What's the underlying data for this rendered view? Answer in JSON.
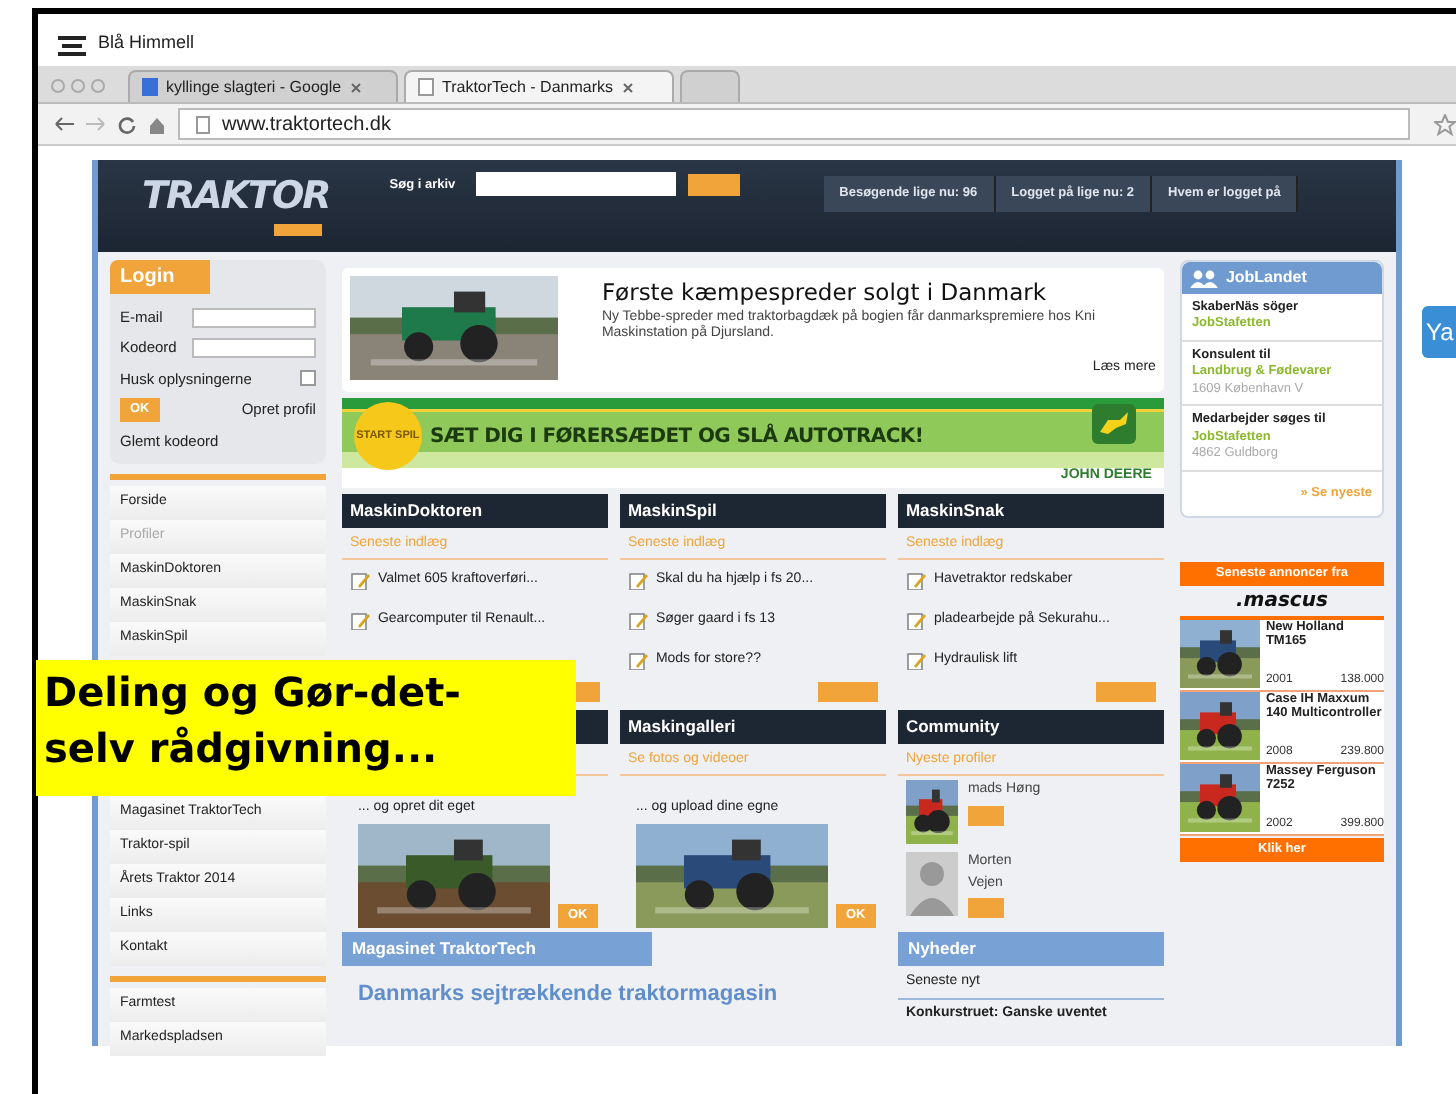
{
  "slide": {
    "caption": "Deling og Gør-det-selv rådgivning..."
  },
  "browser": {
    "app_title": "Blå Himmell",
    "tabs": [
      {
        "label": "kyllinge slagteri - Google",
        "selected": false
      },
      {
        "label": "TraktorTech - Danmarks",
        "selected": true
      }
    ],
    "address": "www.traktortech.dk"
  },
  "header": {
    "logo": "TRAKTOR",
    "search_label": "Søg i arkiv",
    "stats": [
      "Besøgende lige nu: 96",
      "Logget på lige nu: 2",
      "Hvem er logget på"
    ]
  },
  "login": {
    "title": "Login",
    "email_label": "E-mail",
    "password_label": "Kodeord",
    "remember_label": "Husk oplysningerne",
    "remember_checked": false,
    "ok": "OK",
    "create": "Opret profil",
    "forgot": "Glemt kodeord"
  },
  "nav_groups": [
    {
      "divider_before": true,
      "items": [
        {
          "label": "Forside",
          "disabled": false
        },
        {
          "label": "Profiler",
          "disabled": true
        },
        {
          "label": "MaskinDoktoren",
          "disabled": false
        },
        {
          "label": "MaskinSnak",
          "disabled": false
        },
        {
          "label": "MaskinSpil",
          "disabled": false
        }
      ]
    },
    {
      "divider_before": false,
      "items": [
        {
          "label": "Magasinet TraktorTech",
          "disabled": false
        },
        {
          "label": "Traktor-spil",
          "disabled": false
        },
        {
          "label": "Årets Traktor 2014",
          "disabled": false
        },
        {
          "label": "Links",
          "disabled": false
        },
        {
          "label": "Kontakt",
          "disabled": false
        }
      ]
    },
    {
      "divider_before": true,
      "items": [
        {
          "label": "Farmtest",
          "disabled": false
        },
        {
          "label": "Markedspladsen",
          "disabled": false
        }
      ]
    }
  ],
  "feature": {
    "title": "Første kæmpespreder solgt i Danmark",
    "text": "Ny Tebbe-spreder med traktorbagdæk på bogien får danmarkspremiere hos Kni Maskinstation på Djursland.",
    "more": "Læs mere"
  },
  "banner": {
    "badge": "START SPIL",
    "text": "SÆT DIG I FØRERSÆDET OG SLÅ AUTOTRACK!",
    "brand": "JOHN DEERE"
  },
  "forums": [
    {
      "title": "MaskinDoktoren",
      "subtitle": "Seneste indlæg",
      "posts": [
        "Valmet 605 kraftoverføri...",
        "Gearcomputer til Renault..."
      ]
    },
    {
      "title": "MaskinSpil",
      "subtitle": "Seneste indlæg",
      "posts": [
        "Skal du ha hjælp i fs 20...",
        "Søger gaard i fs 13",
        "Mods for store??"
      ]
    },
    {
      "title": "MaskinSnak",
      "subtitle": "Seneste indlæg",
      "posts": [
        "Havetraktor redskaber",
        "pladearbejde på Sekurahu...",
        "Hydraulisk lift"
      ]
    }
  ],
  "galleries": [
    {
      "text": "... og opret dit eget",
      "button": "OK"
    },
    {
      "title": "Maskingalleri",
      "subtitle": "Se fotos og videoer",
      "text": "... og upload dine egne",
      "button": "OK"
    }
  ],
  "community": {
    "title": "Community",
    "subtitle": "Nyeste profiler",
    "profiles": [
      {
        "name": "mads Høng",
        "photo": true
      },
      {
        "name": "Morten Vejen",
        "photo": false
      }
    ]
  },
  "magazine": {
    "title": "Magasinet TraktorTech",
    "headline": "Danmarks sejtrækkende traktormagasin"
  },
  "news": {
    "title": "Nyheder",
    "subtitle": "Seneste nyt",
    "first": "Konkurstruet: Ganske uventet"
  },
  "jobs": {
    "title": "JobLandet",
    "items": [
      {
        "title": "SkaberNäs söger",
        "company": "JobStafetten"
      },
      {
        "title": "Konsulent til",
        "company": "Landbrug & Fødevarer",
        "place": "1609 København V"
      },
      {
        "title": "Medarbejder søges til",
        "company": "JobStafetten",
        "place": "4862 Guldborg"
      }
    ],
    "more": "» Se nyeste"
  },
  "mascus": {
    "header": "Seneste annoncer fra",
    "brand": ".mascus",
    "ads": [
      {
        "title": "New Holland TM165",
        "year": "2001",
        "price": "138.000"
      },
      {
        "title": "Case IH Maxxum 140 Multicontroller",
        "year": "2008",
        "price": "239.800"
      },
      {
        "title": "Massey Ferguson 7252",
        "year": "2002",
        "price": "399.800"
      }
    ],
    "cta": "Klik her"
  },
  "side_tab": "Ya"
}
